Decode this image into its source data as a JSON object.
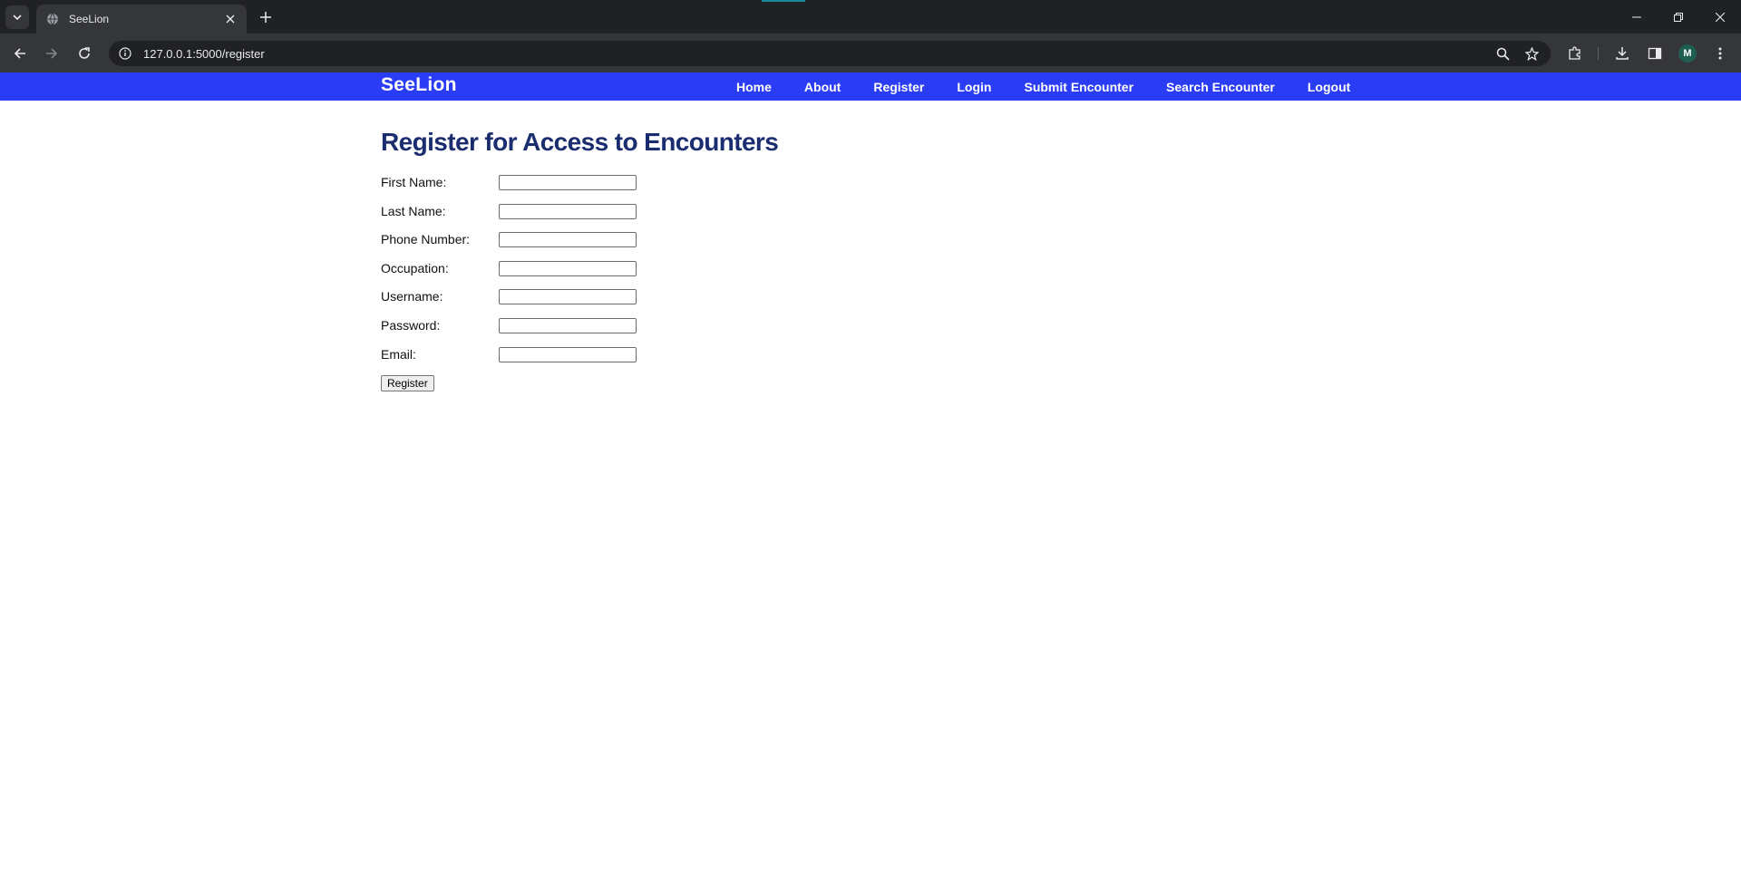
{
  "browser": {
    "tab_title": "SeeLion",
    "url": "127.0.0.1:5000/register",
    "profile_initial": "M"
  },
  "site": {
    "brand": "SeeLion",
    "nav": [
      "Home",
      "About",
      "Register",
      "Login",
      "Submit Encounter",
      "Search Encounter",
      "Logout"
    ],
    "nav_color": "#2b3cf5"
  },
  "form": {
    "title": "Register for Access to Encounters",
    "fields": [
      {
        "label": "First Name:",
        "value": ""
      },
      {
        "label": "Last Name:",
        "value": ""
      },
      {
        "label": "Phone Number:",
        "value": ""
      },
      {
        "label": "Occupation:",
        "value": ""
      },
      {
        "label": "Username:",
        "value": ""
      },
      {
        "label": "Password:",
        "value": ""
      },
      {
        "label": "Email:",
        "value": ""
      }
    ],
    "submit_label": "Register"
  }
}
